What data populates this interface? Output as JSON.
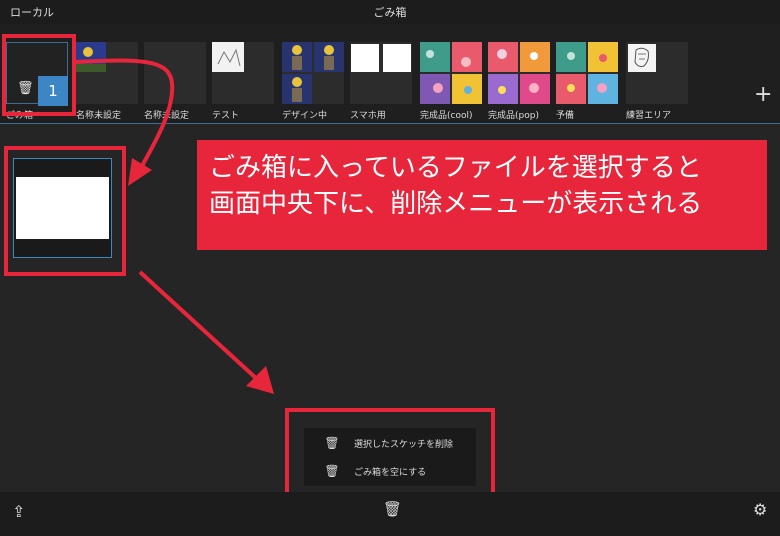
{
  "header": {
    "left_label": "ローカル",
    "title": "ごみ箱"
  },
  "folders": [
    {
      "label": "ごみ箱",
      "badge": "1"
    },
    {
      "label": "名称未設定"
    },
    {
      "label": "名称未設定"
    },
    {
      "label": "テスト"
    },
    {
      "label": "デザイン中"
    },
    {
      "label": "スマホ用"
    },
    {
      "label": "完成品(cool)"
    },
    {
      "label": "完成品(pop)"
    },
    {
      "label": "予備"
    },
    {
      "label": "練習エリア"
    }
  ],
  "add_button": "+",
  "callout": {
    "line1": "ごみ箱に入っているファイルを選択すると",
    "line2": "画面中央下に、削除メニューが表示される"
  },
  "menu": {
    "item1": "選択したスケッチを削除",
    "item2": "ごみ箱を空にする"
  },
  "icons": {
    "trash": "trash-icon",
    "export": "export-icon",
    "settings": "gear-icon"
  },
  "colors": {
    "annotation_red": "#e8263b",
    "accent_blue": "#3d86c6"
  }
}
